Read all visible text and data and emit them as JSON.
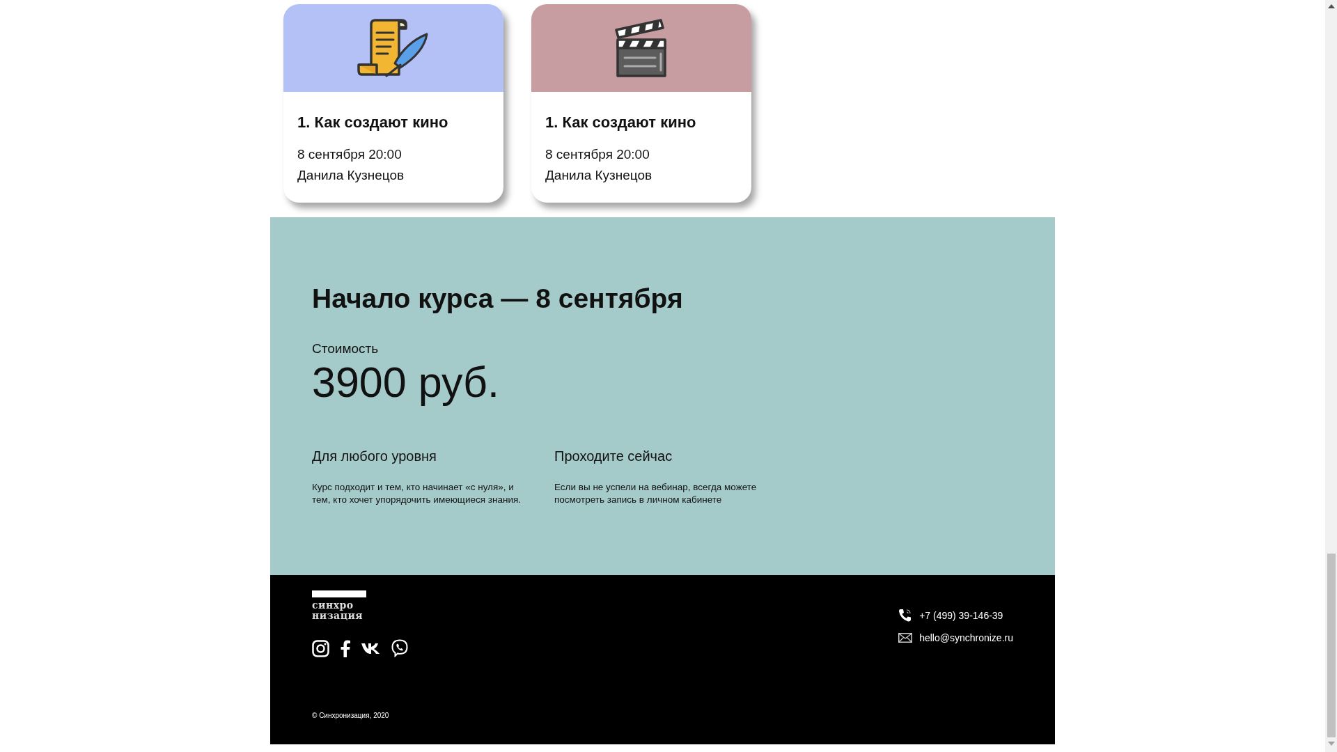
{
  "lessons": [
    {
      "kind": "scroll",
      "color": "#b3c1f7",
      "title": "1. Как создают кино",
      "date": "8 сентября 20:00",
      "author": "Данила Кузнецов"
    },
    {
      "kind": "clapper",
      "color": "#c89da2",
      "title": "1. Как создают кино",
      "date": "8 сентября 20:00",
      "author": "Данила Кузнецов"
    }
  ],
  "course": {
    "heading": "Начало курса — 8 сентября",
    "price_label": "Стоимость",
    "price": "3900 руб.",
    "features": [
      {
        "title": "Для любого уровня",
        "text": "Курс подходит и тем, кто начинает «с нуля», и тем, кто хочет упорядочить имеющиеся знания."
      },
      {
        "title": "Проходите сейчас",
        "text": "Если вы не успели на вебинар, всегда можете посмотреть запись в личном кабинете"
      }
    ]
  },
  "footer": {
    "logo": [
      "синхро",
      "низация"
    ],
    "socials": [
      {
        "kind": "instagram"
      },
      {
        "kind": "facebook"
      },
      {
        "kind": "vk"
      },
      {
        "kind": "viber"
      }
    ],
    "contacts": [
      {
        "kind": "phone",
        "text": "+7 (499) 39-146-39"
      },
      {
        "kind": "email",
        "text": "hello@synchronize.ru"
      }
    ],
    "copyright": "© Синхронизация, 2020"
  }
}
